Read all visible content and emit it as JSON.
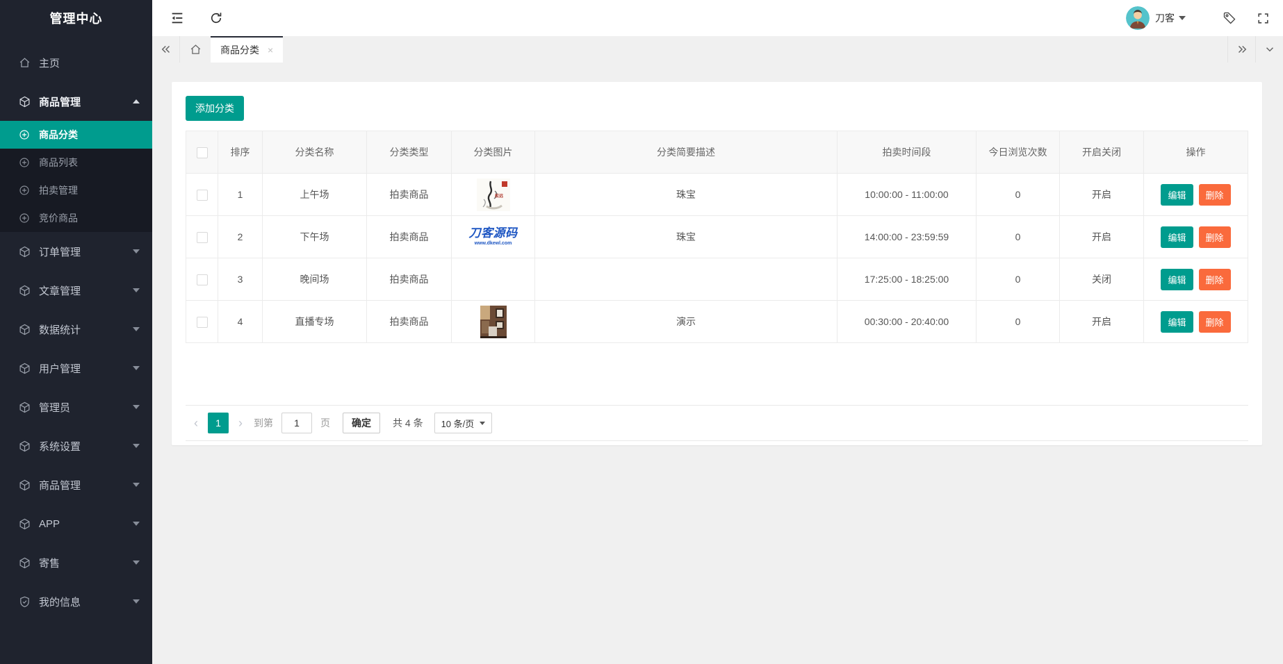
{
  "colors": {
    "accent": "#009c8e",
    "danger": "#fa6a3c",
    "sidebar_bg": "#1f232e"
  },
  "sidebar": {
    "title": "管理中心",
    "home": "主页",
    "goods_group": "商品管理",
    "sub": [
      "商品分类",
      "商品列表",
      "拍卖管理",
      "竞价商品"
    ],
    "groups": [
      "订单管理",
      "文章管理",
      "数据统计",
      "用户管理",
      "管理员",
      "系统设置",
      "商品管理",
      "APP",
      "寄售",
      "我的信息"
    ]
  },
  "topbar": {
    "user_name": "刀客"
  },
  "tabs": {
    "active": "商品分类",
    "close": "×"
  },
  "panel": {
    "add_button": "添加分类"
  },
  "table": {
    "headers": [
      "排序",
      "分类名称",
      "分类类型",
      "分类图片",
      "分类简要描述",
      "拍卖时间段",
      "今日浏览次数",
      "开启关闭",
      "操作"
    ],
    "actions": {
      "edit": "编辑",
      "delete": "删除"
    },
    "rows": [
      {
        "order": "1",
        "name": "上午场",
        "type": "拍卖商品",
        "desc": "珠宝",
        "time": "10:00:00  -  11:00:00",
        "views": "0",
        "status": "开启"
      },
      {
        "order": "2",
        "name": "下午场",
        "type": "拍卖商品",
        "logo_text": "刀客源码",
        "logo_sub": "www.dkewl.com",
        "desc": "珠宝",
        "time": "14:00:00  -  23:59:59",
        "views": "0",
        "status": "开启"
      },
      {
        "order": "3",
        "name": "晚间场",
        "type": "拍卖商品",
        "desc": "",
        "time": "17:25:00  -  18:25:00",
        "views": "0",
        "status": "关闭"
      },
      {
        "order": "4",
        "name": "直播专场",
        "type": "拍卖商品",
        "desc": "演示",
        "time": "00:30:00  -  20:40:00",
        "views": "0",
        "status": "开启"
      }
    ]
  },
  "pagination": {
    "page": "1",
    "goto_label": "到第",
    "goto_value": "1",
    "page_unit": "页",
    "confirm": "确定",
    "total": "共 4 条",
    "per_page": "10 条/页"
  }
}
